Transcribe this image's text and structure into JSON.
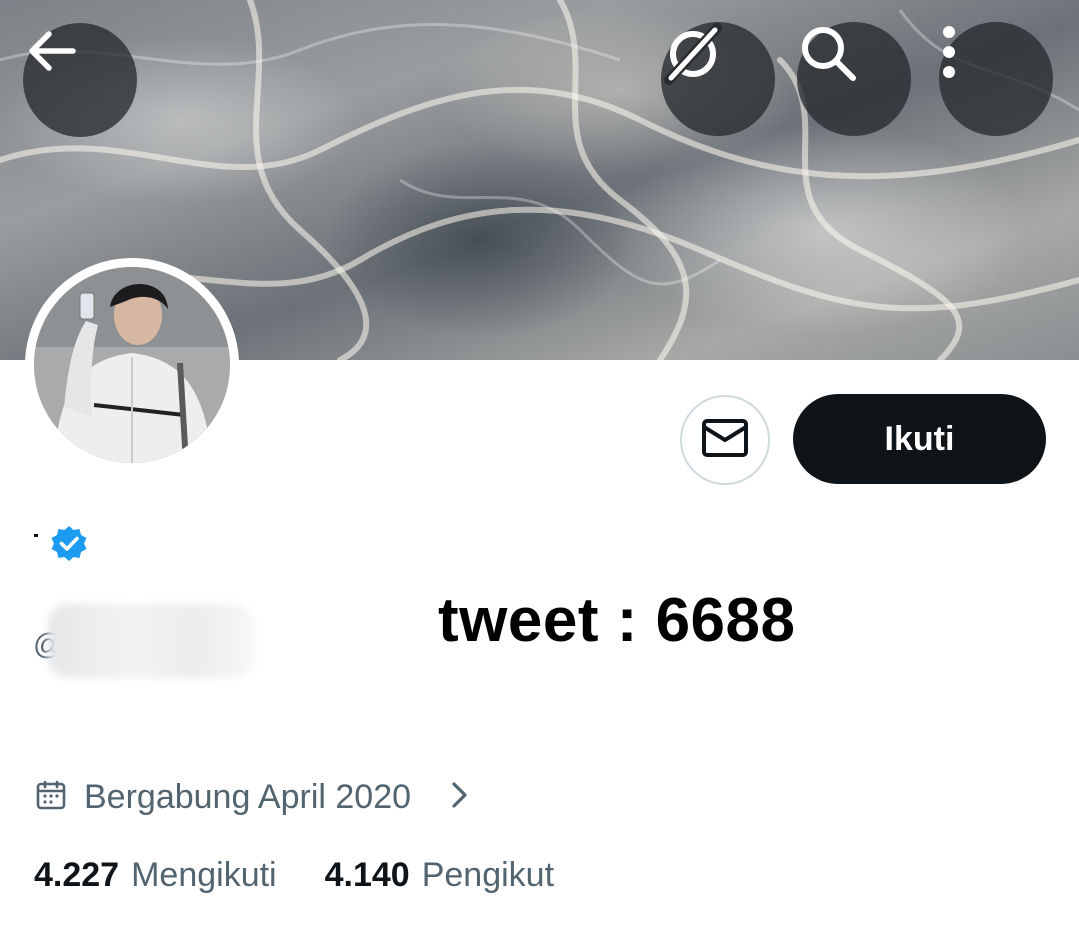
{
  "header": {
    "back_icon": "arrow-left-icon",
    "grok_icon": "grok-icon",
    "search_icon": "search-icon",
    "more_icon": "more-vertical-icon"
  },
  "profile": {
    "verified_icon": "verified-badge-icon",
    "handle_prefix": "@",
    "tweet_count": "tweet : 6688",
    "joined_icon": "calendar-icon",
    "joined_text": "Bergabung April 2020"
  },
  "actions": {
    "message_icon": "mail-icon",
    "follow_label": "Ikuti"
  },
  "stats": {
    "following_count": "4.227",
    "following_label": "Mengikuti",
    "followers_count": "4.140",
    "followers_label": "Pengikut"
  },
  "colors": {
    "primary_text": "#0f1419",
    "secondary_text": "#536471",
    "verified_blue": "#1d9bf0",
    "follow_button_bg": "#0f1419"
  }
}
